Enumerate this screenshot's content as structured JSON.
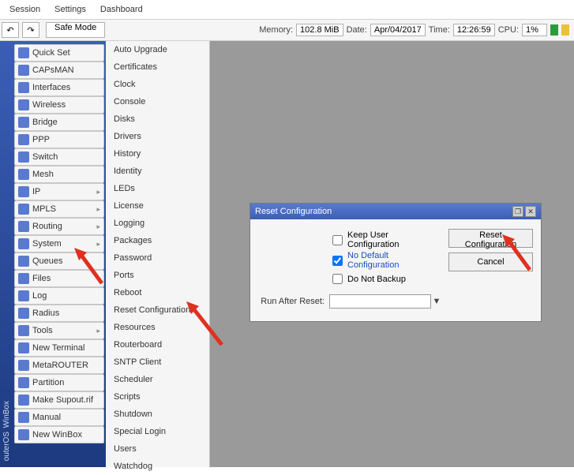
{
  "menubar": [
    "Session",
    "Settings",
    "Dashboard"
  ],
  "toolbar": {
    "undo": "↶",
    "redo": "↷",
    "safemode": "Safe Mode"
  },
  "status": {
    "memory_label": "Memory:",
    "memory": "102.8 MiB",
    "date_label": "Date:",
    "date": "Apr/04/2017",
    "time_label": "Time:",
    "time": "12:26:59",
    "cpu_label": "CPU:",
    "cpu": "1%"
  },
  "vtabs": [
    "outerOS",
    "WinBox"
  ],
  "sidebar": [
    {
      "label": "Quick Set",
      "arrow": false
    },
    {
      "label": "CAPsMAN",
      "arrow": false
    },
    {
      "label": "Interfaces",
      "arrow": false
    },
    {
      "label": "Wireless",
      "arrow": false
    },
    {
      "label": "Bridge",
      "arrow": false
    },
    {
      "label": "PPP",
      "arrow": false
    },
    {
      "label": "Switch",
      "arrow": false
    },
    {
      "label": "Mesh",
      "arrow": false
    },
    {
      "label": "IP",
      "arrow": true
    },
    {
      "label": "MPLS",
      "arrow": true
    },
    {
      "label": "Routing",
      "arrow": true
    },
    {
      "label": "System",
      "arrow": true
    },
    {
      "label": "Queues",
      "arrow": false
    },
    {
      "label": "Files",
      "arrow": false
    },
    {
      "label": "Log",
      "arrow": false
    },
    {
      "label": "Radius",
      "arrow": false
    },
    {
      "label": "Tools",
      "arrow": true
    },
    {
      "label": "New Terminal",
      "arrow": false
    },
    {
      "label": "MetaROUTER",
      "arrow": false
    },
    {
      "label": "Partition",
      "arrow": false
    },
    {
      "label": "Make Supout.rif",
      "arrow": false
    },
    {
      "label": "Manual",
      "arrow": false
    },
    {
      "label": "New WinBox",
      "arrow": false
    }
  ],
  "submenu": [
    "Auto Upgrade",
    "Certificates",
    "Clock",
    "Console",
    "Disks",
    "Drivers",
    "History",
    "Identity",
    "LEDs",
    "License",
    "Logging",
    "Packages",
    "Password",
    "Ports",
    "Reboot",
    "Reset Configuration",
    "Resources",
    "Routerboard",
    "SNTP Client",
    "Scheduler",
    "Scripts",
    "Shutdown",
    "Special Login",
    "Users",
    "Watchdog"
  ],
  "dialog": {
    "title": "Reset Configuration",
    "keep": "Keep User Configuration",
    "nodef": "No Default Configuration",
    "nobak": "Do Not Backup",
    "runafter": "Run After Reset:",
    "reset": "Reset Configuration",
    "cancel": "Cancel",
    "dd_caret": "▼"
  }
}
